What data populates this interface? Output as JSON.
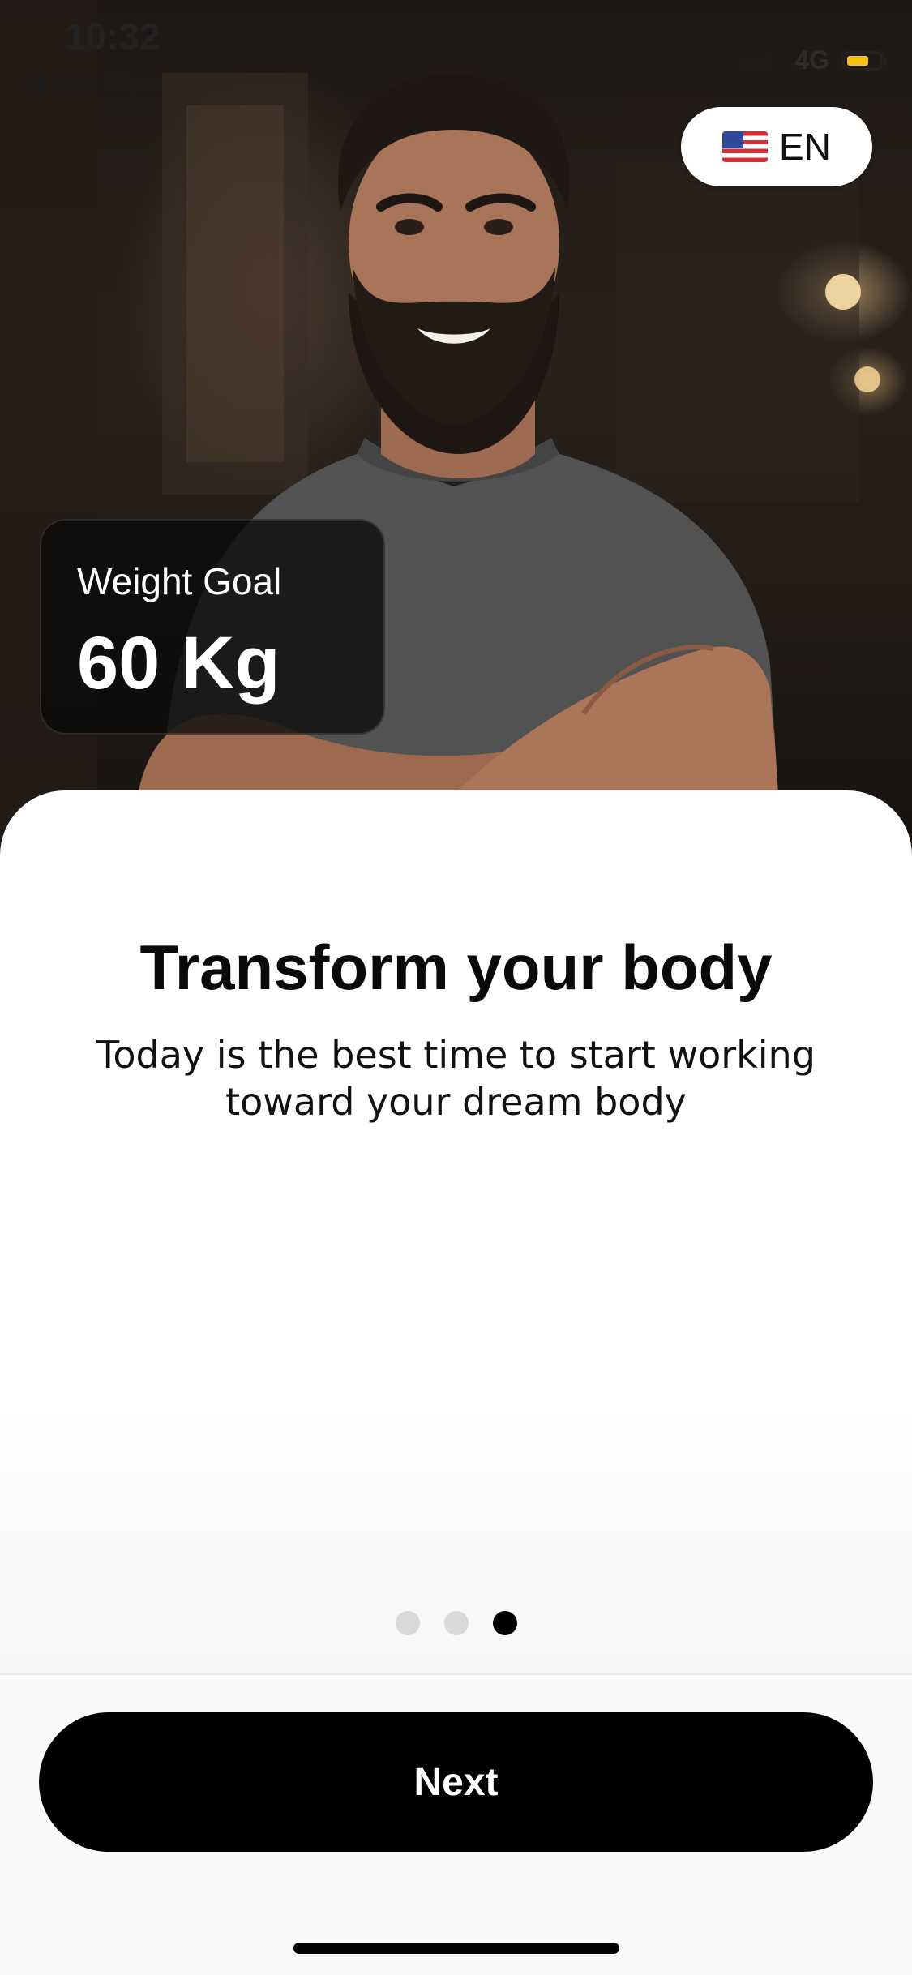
{
  "status_bar": {
    "time": "10:32",
    "back_app": "App Store",
    "back_arrow": "◀",
    "network": "4G",
    "signal_level": 3,
    "battery_color": "#f3c316"
  },
  "language_selector": {
    "flag_icon": "us-flag-icon",
    "label": "EN"
  },
  "goal_card": {
    "label": "Weight Goal",
    "value": "60 Kg"
  },
  "content": {
    "title": "Transform your body",
    "subtitle": "Today is the best time to start working toward your dream body"
  },
  "pagination": {
    "total": 3,
    "active_index": 2
  },
  "actions": {
    "next_label": "Next"
  }
}
